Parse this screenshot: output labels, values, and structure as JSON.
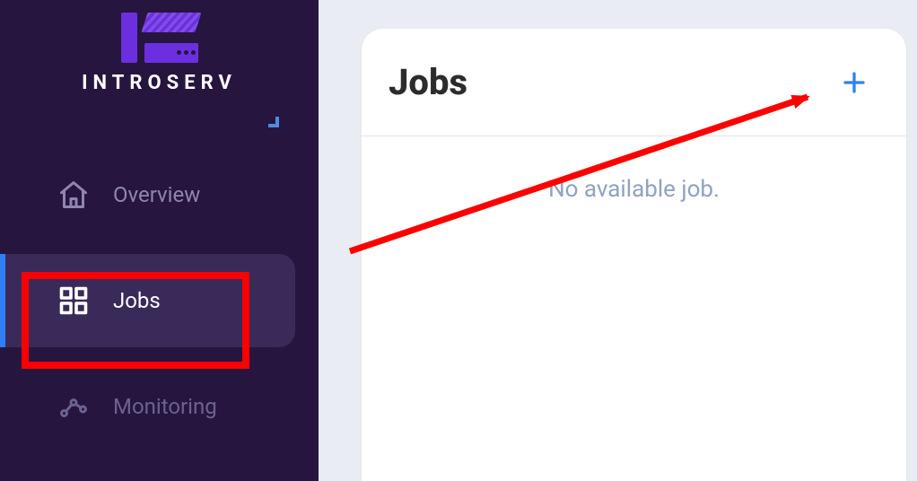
{
  "brand": {
    "name": "INTROSERV"
  },
  "sidebar": {
    "items": [
      {
        "label": "Overview"
      },
      {
        "label": "Jobs"
      },
      {
        "label": "Monitoring"
      }
    ]
  },
  "main": {
    "title": "Jobs",
    "empty_message": "No available job."
  },
  "colors": {
    "accent_blue": "#2f7ef7",
    "annotation_red": "#fe0000"
  }
}
